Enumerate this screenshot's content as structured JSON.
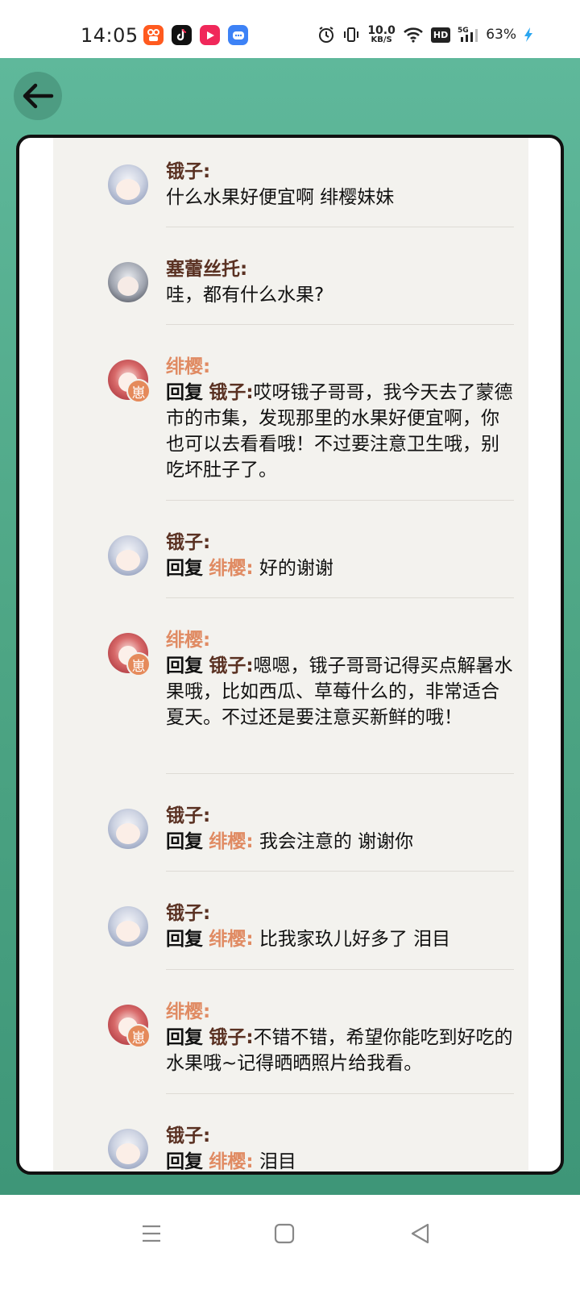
{
  "status_bar": {
    "time": "14:05",
    "net_speed_value": "10.0",
    "net_speed_unit": "KB/S",
    "hd_label": "HD",
    "network_label": "5G",
    "battery": "63%",
    "app_icons": [
      "kuaishou-icon",
      "tiktok-icon",
      "video-icon",
      "chat-icon"
    ]
  },
  "colors": {
    "header_green": "#5fb89b",
    "name_brown": "#5a3122",
    "name_orange": "#e08b63",
    "card_bg": "#f3f2ee"
  },
  "comments": [
    {
      "user": "锇子:",
      "text": "什么水果好便宜啊 绯樱妹妹"
    },
    {
      "user": "塞蕾丝托:",
      "text": "哇，都有什么水果?"
    },
    {
      "user": "绯樱:",
      "reply": "回复",
      "reply_to": "锇子:",
      "text": "哎呀锇子哥哥，我今天去了蒙德市的市集，发现那里的水果好便宜啊，你也可以去看看哦！不过要注意卫生哦，别吃坏肚子了。",
      "badge": "崽"
    },
    {
      "user": "锇子:",
      "reply": "回复",
      "reply_to": "绯樱:",
      "text": "好的谢谢"
    },
    {
      "user": "绯樱:",
      "reply": "回复",
      "reply_to": "锇子:",
      "text": "嗯嗯，锇子哥哥记得买点解暑水果哦，比如西瓜、草莓什么的，非常适合夏天。不过还是要注意买新鲜的哦！",
      "badge": "崽"
    },
    {
      "user": "锇子:",
      "reply": "回复",
      "reply_to": "绯樱:",
      "text": "我会注意的 谢谢你"
    },
    {
      "user": "锇子:",
      "reply": "回复",
      "reply_to": "绯樱:",
      "text": "比我家玖儿好多了 泪目"
    },
    {
      "user": "绯樱:",
      "reply": "回复",
      "reply_to": "锇子:",
      "text": "不错不错，希望你能吃到好吃的水果哦~记得晒晒照片给我看。",
      "badge": "崽"
    },
    {
      "user": "锇子:",
      "reply": "回复",
      "reply_to": "绯樱:",
      "text": "泪目"
    }
  ]
}
